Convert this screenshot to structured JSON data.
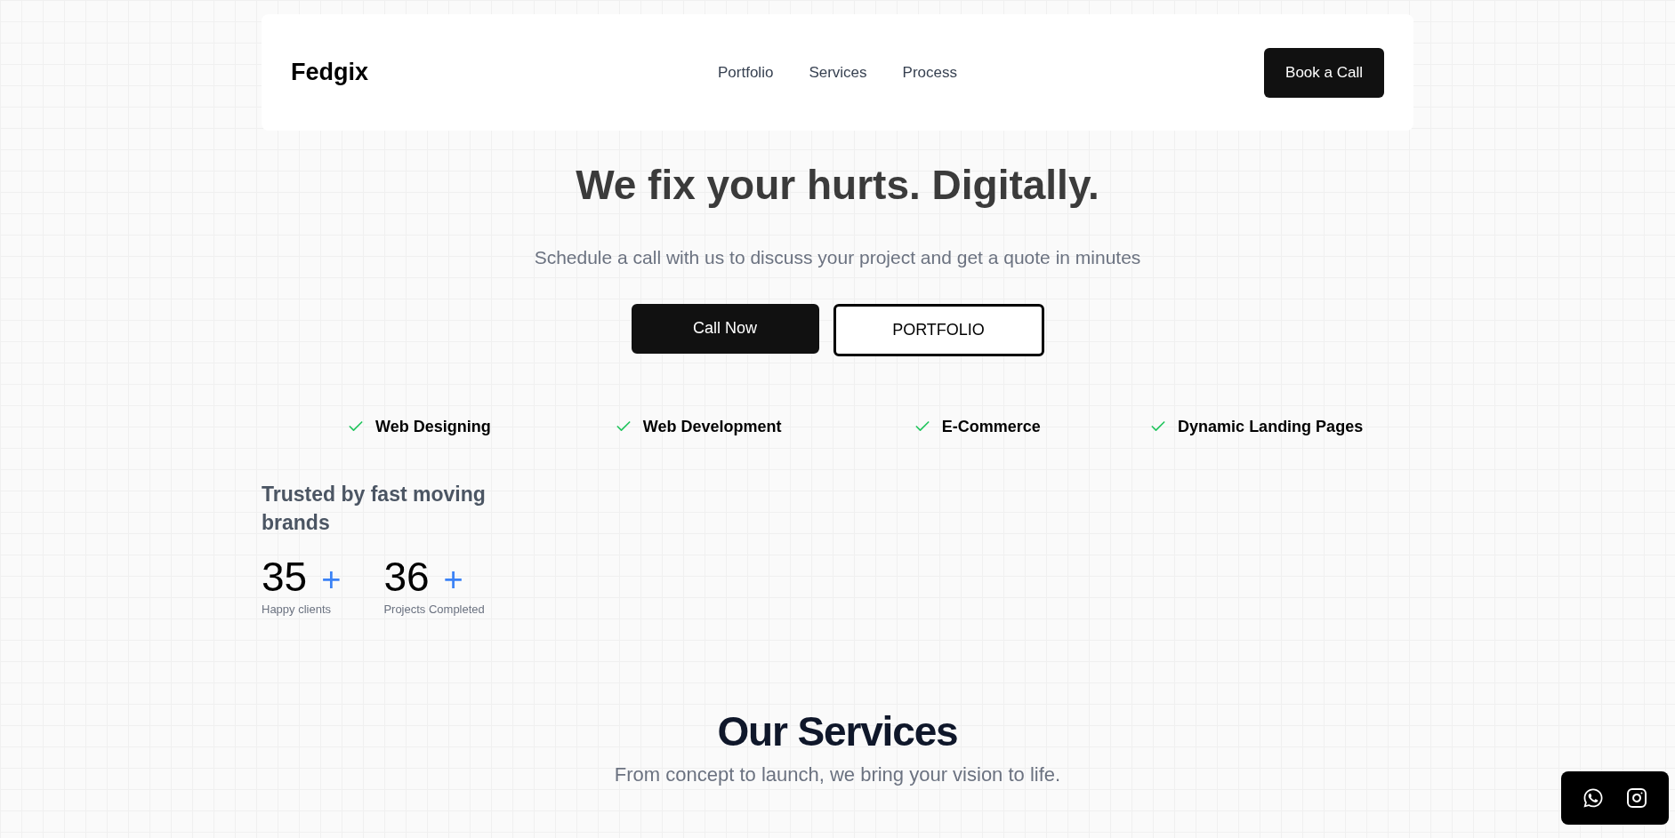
{
  "header": {
    "logo": "Fedgix",
    "nav": [
      "Portfolio",
      "Services",
      "Process"
    ],
    "cta": "Book a Call"
  },
  "hero": {
    "title": "We fix your hurts. Digitally.",
    "subtitle": "Schedule a call with us to discuss your project and get a quote in minutes",
    "buttons": [
      {
        "label": "Call Now",
        "kind": "primary"
      },
      {
        "label": "PORTFOLIO",
        "kind": "outline"
      }
    ]
  },
  "features": [
    "Web Designing",
    "Web Development",
    "E-Commerce",
    "Dynamic Landing Pages"
  ],
  "trust": {
    "title": "Trusted by fast moving brands",
    "stats": [
      {
        "value": "35",
        "suffix": "+",
        "label": "Happy clients"
      },
      {
        "value": "36",
        "suffix": "+",
        "label": "Projects Completed"
      }
    ]
  },
  "services": {
    "title": "Our Services",
    "subtitle": "From concept to launch, we bring your vision to life."
  }
}
